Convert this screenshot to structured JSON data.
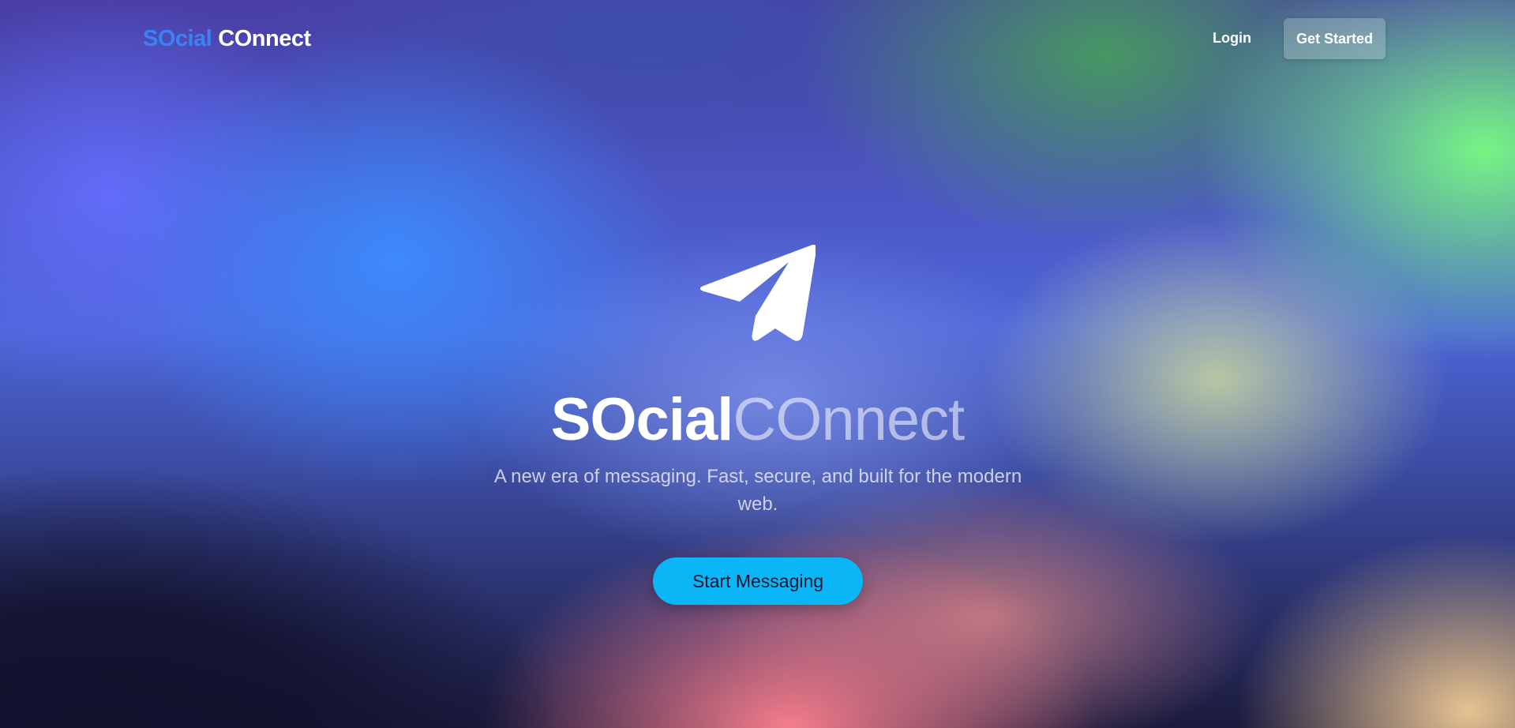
{
  "navbar": {
    "brand_part1": "SOcial",
    "brand_part2": "COnnect",
    "login_label": "Login",
    "cta_label": "Get Started"
  },
  "hero": {
    "icon": "paper-plane-icon",
    "title_part1": "SOcial",
    "title_part2": "COnnect",
    "subtitle": "A new era of messaging. Fast, secure, and built for the modern web.",
    "cta_label": "Start Messaging"
  },
  "colors": {
    "brand_accent": "#3b82f6",
    "cta_button": "#0bb6f6"
  }
}
